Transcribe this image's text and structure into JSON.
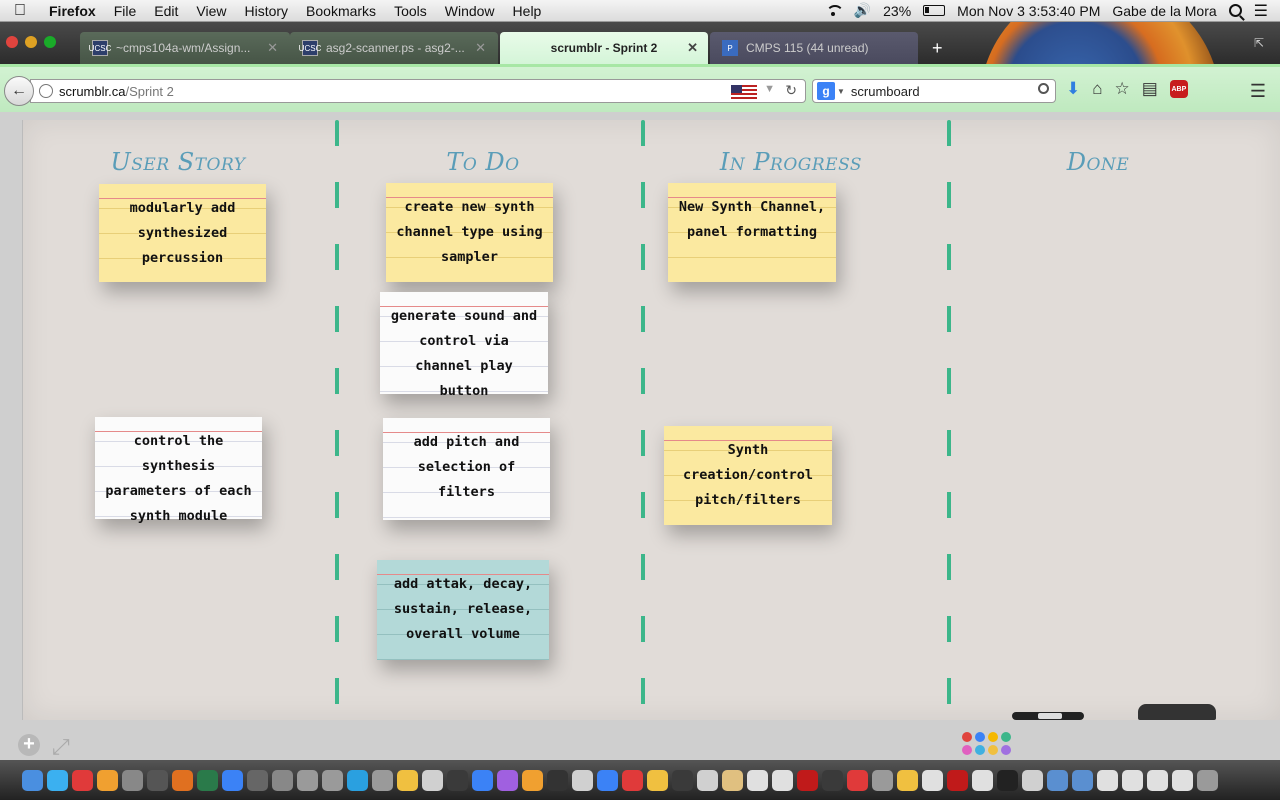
{
  "menubar": {
    "app": "Firefox",
    "items": [
      "File",
      "Edit",
      "View",
      "History",
      "Bookmarks",
      "Tools",
      "Window",
      "Help"
    ],
    "battery": "23%",
    "clock": "Mon Nov 3  3:53:40 PM",
    "user": "Gabe de la Mora"
  },
  "tabs": [
    {
      "label": "~cmps104a-wm/Assign...",
      "favicon": "UCSC"
    },
    {
      "label": "asg2-scanner.ps - asg2-...",
      "favicon": "UCSC"
    },
    {
      "label": "scrumblr - Sprint 2",
      "favicon": ""
    },
    {
      "label": "CMPS 115 (44 unread)",
      "favicon": "P"
    }
  ],
  "nav": {
    "url_host": "scrumblr.ca",
    "url_path": "/Sprint 2",
    "search_value": "scrumboard",
    "search_engine_icon": "g"
  },
  "board": {
    "columns": [
      "User Story",
      "To Do",
      "In Progress",
      "Done"
    ],
    "cards": [
      {
        "text": "modularly add synthesized percussion",
        "color": "yellow"
      },
      {
        "text": "control the synthesis parameters of each synth module",
        "color": "white"
      },
      {
        "text": "create new synth channel type using sampler",
        "color": "yellow"
      },
      {
        "text": "generate sound and control via channel play button",
        "color": "white"
      },
      {
        "text": "add pitch and selection of filters",
        "color": "white"
      },
      {
        "text": "add attak, decay, sustain, release, overall volume",
        "color": "blue"
      },
      {
        "text": "New Synth Channel, panel formatting",
        "color": "yellow"
      },
      {
        "text": "Synth creation/control pitch/filters",
        "color": "yellow"
      }
    ]
  },
  "controls": {
    "add_label": "+",
    "palette": [
      "#e0443e",
      "#3b82f6",
      "#f5b800",
      "#3cb68a",
      "#e060c0",
      "#40b0e0",
      "#f0c040",
      "#a070e0"
    ]
  },
  "dock": {
    "icon_colors": [
      "#4a8fe0",
      "#3bb0f0",
      "#e03a3a",
      "#f0a030",
      "#888888",
      "#555555",
      "#e07020",
      "#2a7a4a",
      "#3b82f6",
      "#666666",
      "#888888",
      "#9a9a9a",
      "#9a9a9a",
      "#2aa0e0",
      "#9a9a9a",
      "#f0c040",
      "#d0d0d0",
      "#3a3a3a",
      "#3b82f6",
      "#a060e0",
      "#f0a030",
      "#333333",
      "#d0d0d0",
      "#3b82f6",
      "#e03a3a",
      "#f0c040",
      "#3a3a3a",
      "#d0d0d0",
      "#e0c080",
      "#e0e0e0",
      "#e0e0e0",
      "#c01a1a",
      "#3a3a3a",
      "#e03a3a",
      "#9a9a9a",
      "#f0c040",
      "#e0e0e0",
      "#c01a1a",
      "#e0e0e0",
      "#222222",
      "#d0d0d0",
      "#5a8fd0",
      "#5a8fd0",
      "#e0e0e0",
      "#e0e0e0",
      "#e0e0e0",
      "#e0e0e0",
      "#9a9a9a"
    ]
  }
}
